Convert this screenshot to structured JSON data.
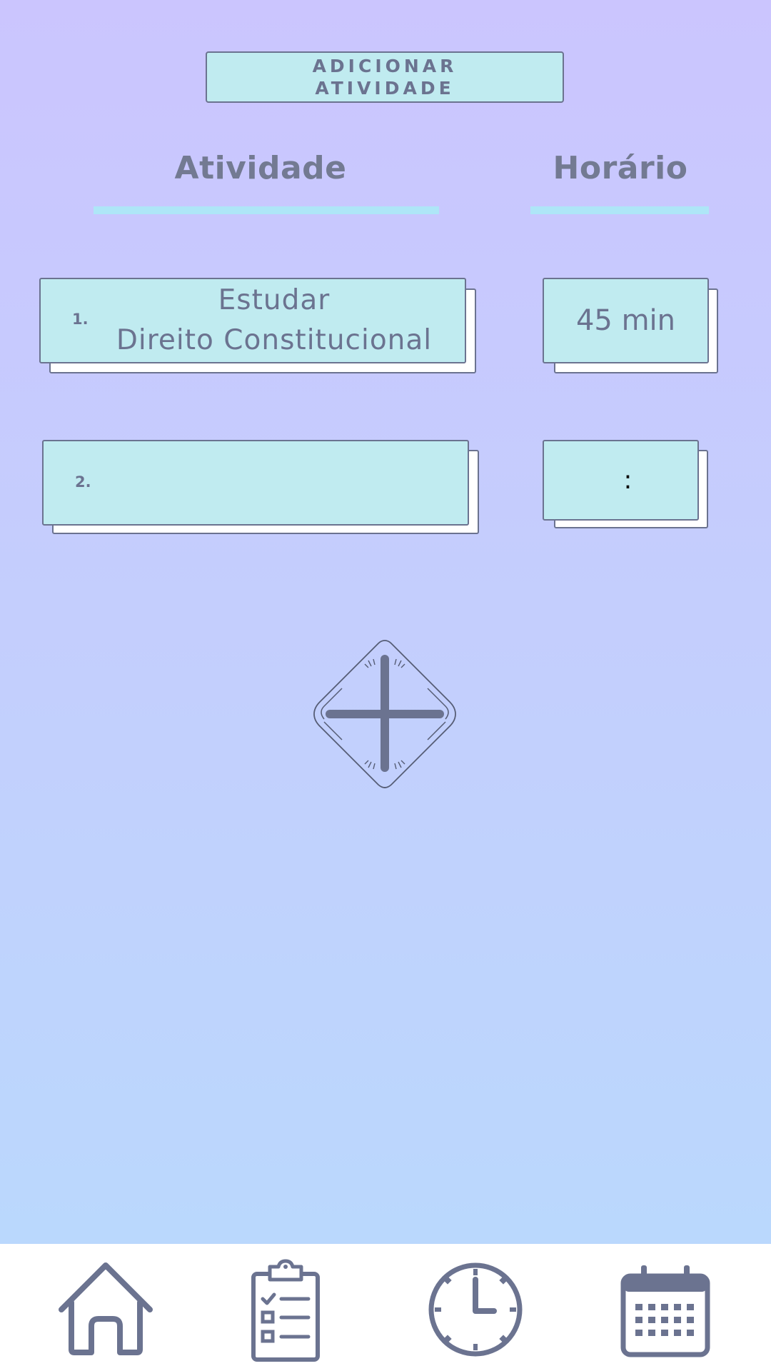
{
  "header": {
    "add_activity_label": "ADICIONAR\nATIVIDADE"
  },
  "columns": {
    "activity": "Atividade",
    "time": "Horário"
  },
  "activities": [
    {
      "number": "1.",
      "name": "Estudar\nDireito Constitucional",
      "time": "45 min"
    },
    {
      "number": "2.",
      "name": "",
      "time": ":"
    }
  ],
  "add_button": {
    "icon": "plus-icon"
  },
  "bottom_nav": [
    {
      "icon": "home-icon"
    },
    {
      "icon": "clipboard-checklist-icon"
    },
    {
      "icon": "clock-icon"
    },
    {
      "icon": "calendar-icon"
    }
  ],
  "colors": {
    "background_top": "#cbc5fe",
    "background_bottom": "#b8dafd",
    "card": "#c0ebf0",
    "accent_underline": "#aee6f7",
    "text": "#6b7390",
    "nav_background": "#ffffff"
  }
}
